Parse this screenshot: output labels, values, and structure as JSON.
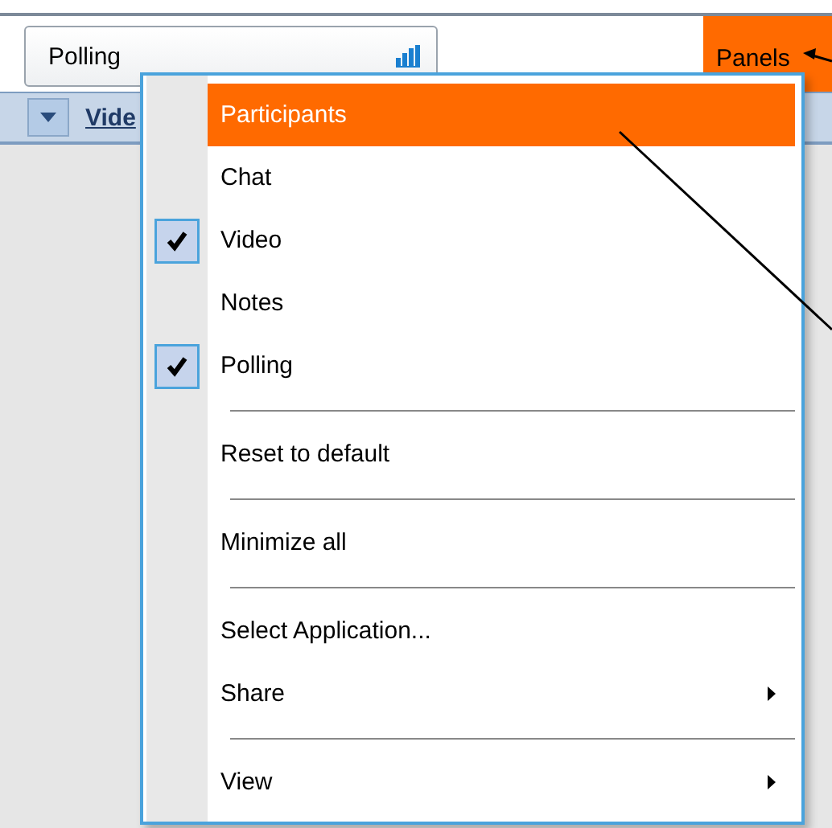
{
  "toolbar": {
    "tab": {
      "label": "Polling"
    },
    "panels_button": {
      "label": "Panels"
    }
  },
  "header": {
    "title": "Vide"
  },
  "menu": {
    "items": [
      {
        "kind": "item",
        "label": "Participants",
        "selected": true,
        "checked": false,
        "submenu": false
      },
      {
        "kind": "item",
        "label": "Chat",
        "selected": false,
        "checked": false,
        "submenu": false
      },
      {
        "kind": "item",
        "label": "Video",
        "selected": false,
        "checked": true,
        "submenu": false
      },
      {
        "kind": "item",
        "label": "Notes",
        "selected": false,
        "checked": false,
        "submenu": false
      },
      {
        "kind": "item",
        "label": "Polling",
        "selected": false,
        "checked": true,
        "submenu": false
      },
      {
        "kind": "separator"
      },
      {
        "kind": "item",
        "label": "Reset to default",
        "selected": false,
        "checked": false,
        "submenu": false
      },
      {
        "kind": "separator"
      },
      {
        "kind": "item",
        "label": "Minimize all",
        "selected": false,
        "checked": false,
        "submenu": false
      },
      {
        "kind": "separator"
      },
      {
        "kind": "item",
        "label": "Select Application...",
        "selected": false,
        "checked": false,
        "submenu": false
      },
      {
        "kind": "item",
        "label": "Share",
        "selected": false,
        "checked": false,
        "submenu": true
      },
      {
        "kind": "separator"
      },
      {
        "kind": "item",
        "label": "View",
        "selected": false,
        "checked": false,
        "submenu": true
      }
    ]
  }
}
